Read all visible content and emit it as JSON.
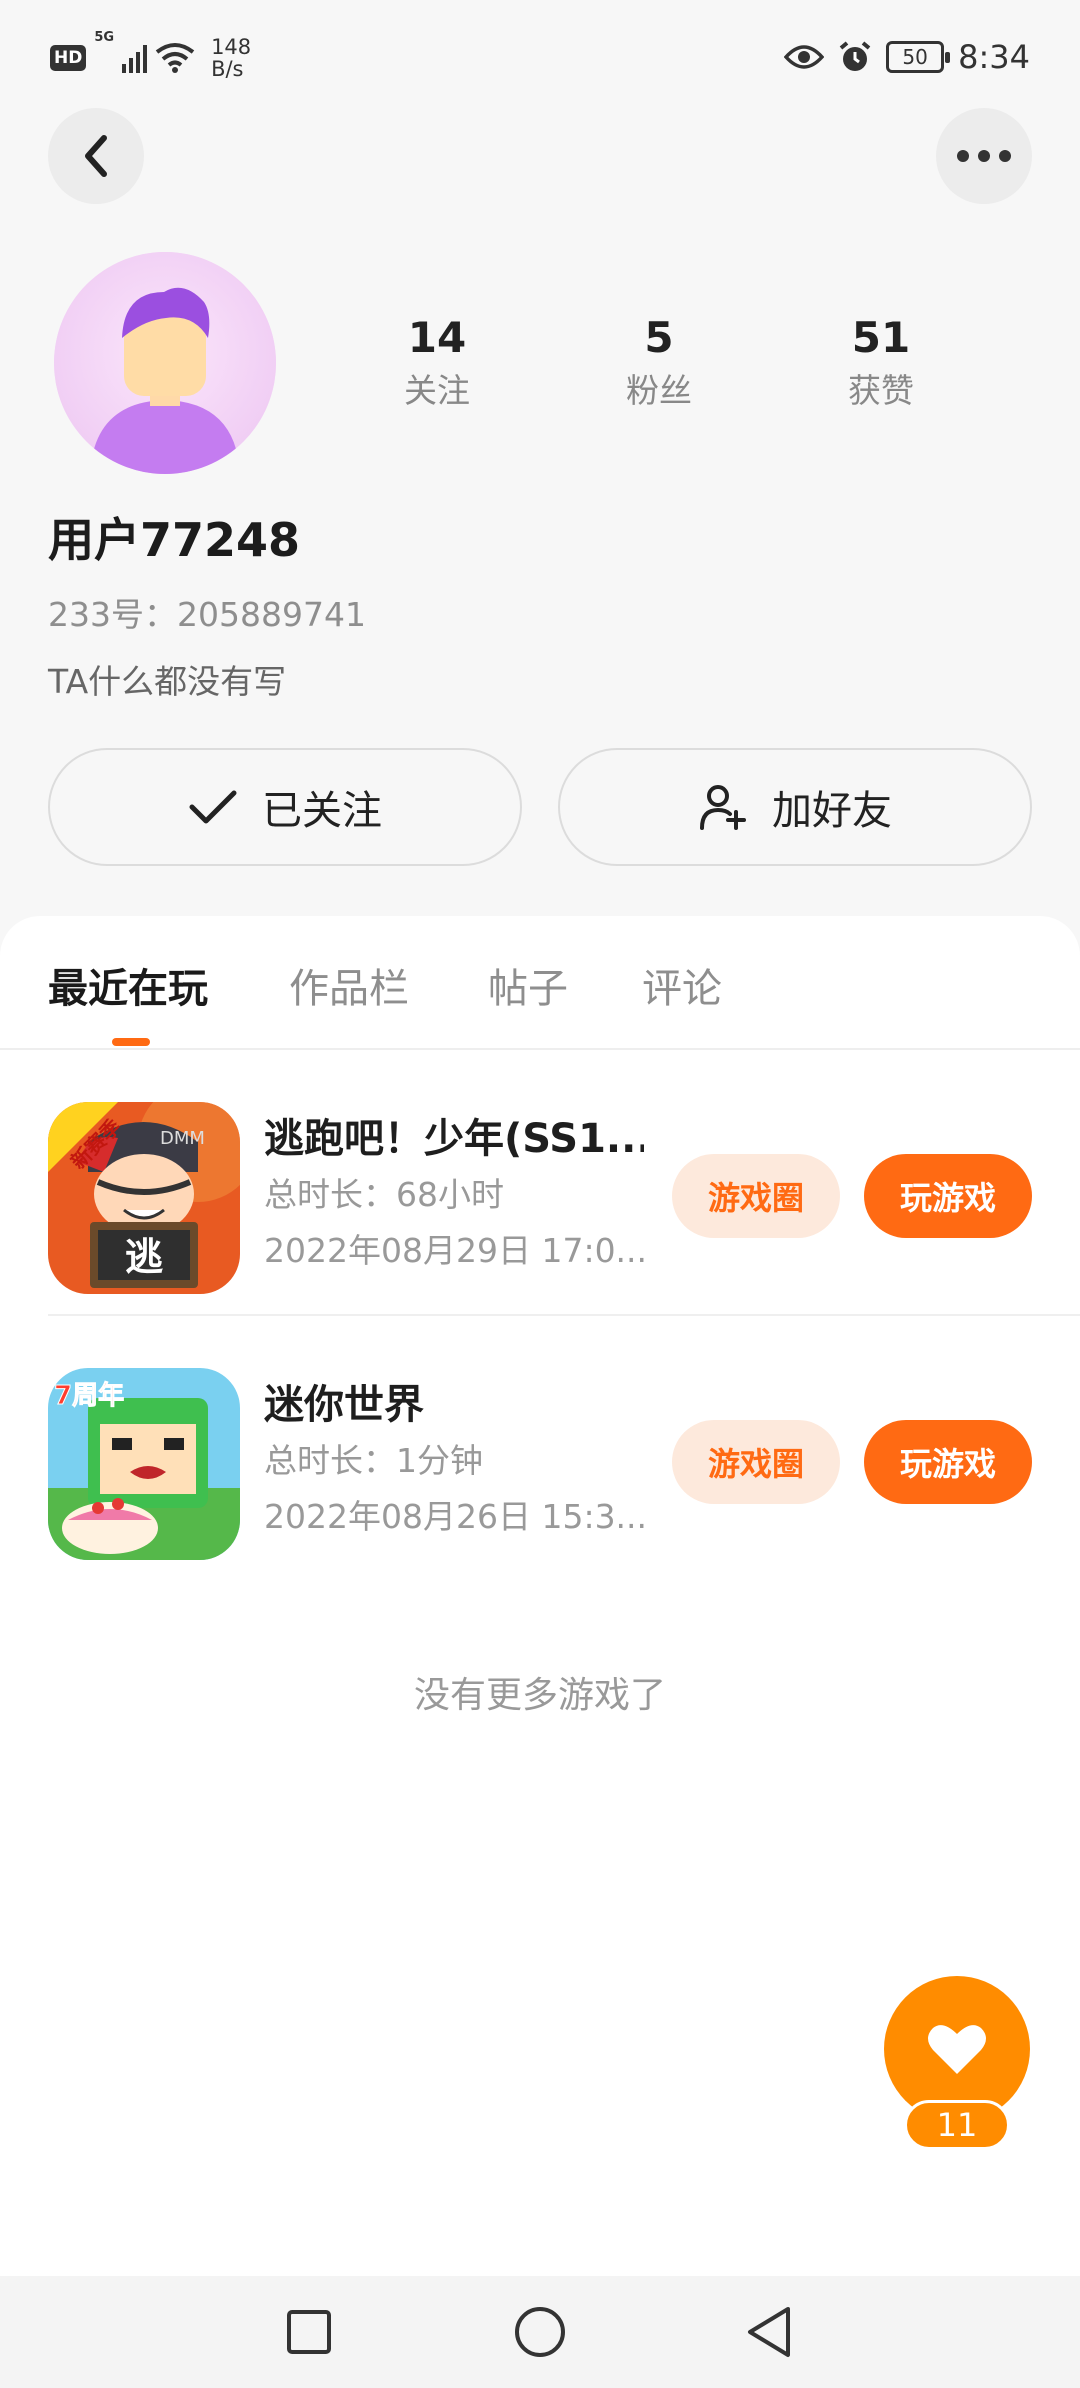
{
  "status_bar": {
    "hd": "HD",
    "signal_type": "5G",
    "net_speed_value": "148",
    "net_speed_unit": "B/s",
    "battery": "50",
    "time": "8:34",
    "icons": [
      "hd-icon",
      "signal-icon",
      "wifi-icon",
      "eye-icon",
      "alarm-icon",
      "battery-icon"
    ]
  },
  "header": {
    "back_icon": "chevron-left-icon",
    "more_icon": "more-horizontal-icon"
  },
  "profile": {
    "avatar_icon": "default-avatar",
    "username": "用户77248",
    "uid": "233号：205889741",
    "bio": "TA什么都没有写",
    "stats": [
      {
        "value": "14",
        "label": "关注"
      },
      {
        "value": "5",
        "label": "粉丝"
      },
      {
        "value": "51",
        "label": "获赞"
      }
    ],
    "follow_button": "已关注",
    "add_friend_button": "加好友"
  },
  "tabs": [
    {
      "label": "最近在玩",
      "active": true
    },
    {
      "label": "作品栏",
      "active": false
    },
    {
      "label": "帖子",
      "active": false
    },
    {
      "label": "评论",
      "active": false
    }
  ],
  "games": [
    {
      "title": "逃跑吧！少年(SS1...",
      "duration": "总时长：68小时",
      "last_played": "2022年08月29日 17:0...",
      "circle_button": "游戏圈",
      "play_button": "玩游戏",
      "icon_badge": "新赛季",
      "icon_sign": "逃",
      "icon_text": "DMM"
    },
    {
      "title": "迷你世界",
      "duration": "总时长：1分钟",
      "last_played": "2022年08月26日 15:3...",
      "circle_button": "游戏圈",
      "play_button": "玩游戏",
      "icon_badge": "7周年"
    }
  ],
  "no_more_text": "没有更多游戏了",
  "like_fab": {
    "count": "11",
    "icon": "heart-icon"
  },
  "accent_color": "#ff6a13",
  "nav_bar": {
    "icons": [
      "recent-apps-icon",
      "home-icon",
      "back-icon"
    ]
  }
}
